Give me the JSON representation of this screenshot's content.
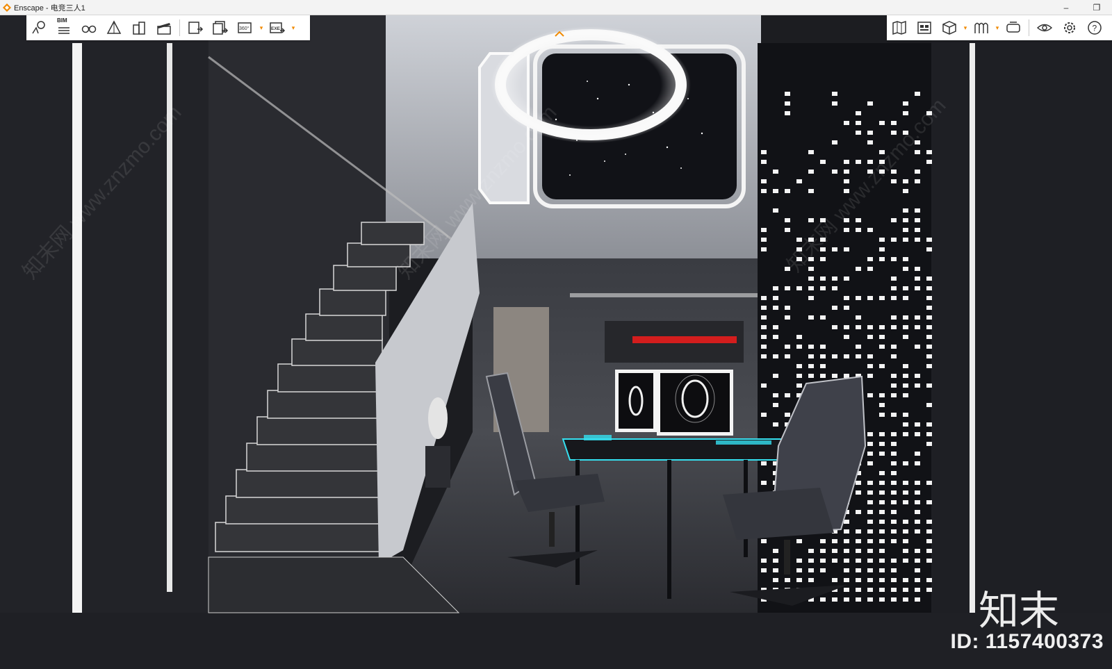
{
  "window": {
    "title": "Enscape - 电竞三人1",
    "minimize_glyph": "–",
    "restore_glyph": "❐"
  },
  "toolbar_left": {
    "bim_label": "BIM",
    "buttons": [
      "map-pin-icon",
      "bim-icon",
      "binoculars-icon",
      "house-icon",
      "buildings-icon",
      "clapperboard-icon",
      "export-image-icon",
      "batch-export-icon",
      "panorama-360-icon",
      "export-exe-icon"
    ],
    "pano_label": "360°",
    "exe_label": "EXE"
  },
  "toolbar_right": {
    "buttons": [
      "map-icon",
      "asset-library-icon",
      "cube-icon",
      "views-icon",
      "vr-headset-icon",
      "eye-icon",
      "settings-icon",
      "help-icon"
    ],
    "help_label": "?"
  },
  "scene": {
    "description_hidden": false
  },
  "watermark": {
    "logo_text": "知末",
    "id_text": "ID: 1157400373",
    "diagonal_text": "知末网 www.znzmo.com"
  },
  "colors": {
    "accent": "#f18a00",
    "led_cyan": "#35e0f0",
    "red_strip": "#d31d1d"
  }
}
